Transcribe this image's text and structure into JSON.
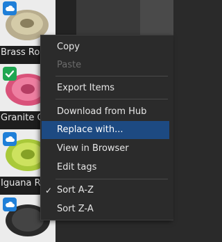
{
  "assets": [
    {
      "name": "Brass Rou",
      "badge": "cloud-icon"
    },
    {
      "name": "Granite C",
      "badge": "checkmark-icon"
    },
    {
      "name": "Iguana Ru",
      "badge": "cloud-icon"
    },
    {
      "name": "",
      "badge": "cloud-icon"
    }
  ],
  "colors": {
    "highlight": "#1d4a82",
    "cloud_badge": "#1f7fd8",
    "check_badge": "#1fa651",
    "menu_background": "#2b2b2b"
  },
  "menu": {
    "copy": "Copy",
    "paste": "Paste",
    "export_items": "Export Items",
    "download_from_hub": "Download from Hub",
    "replace_with": "Replace with...",
    "view_in_browser": "View in Browser",
    "edit_tags": "Edit tags",
    "sort_a_z": "Sort A-Z",
    "sort_z_a": "Sort Z-A",
    "check_mark": "✓"
  }
}
